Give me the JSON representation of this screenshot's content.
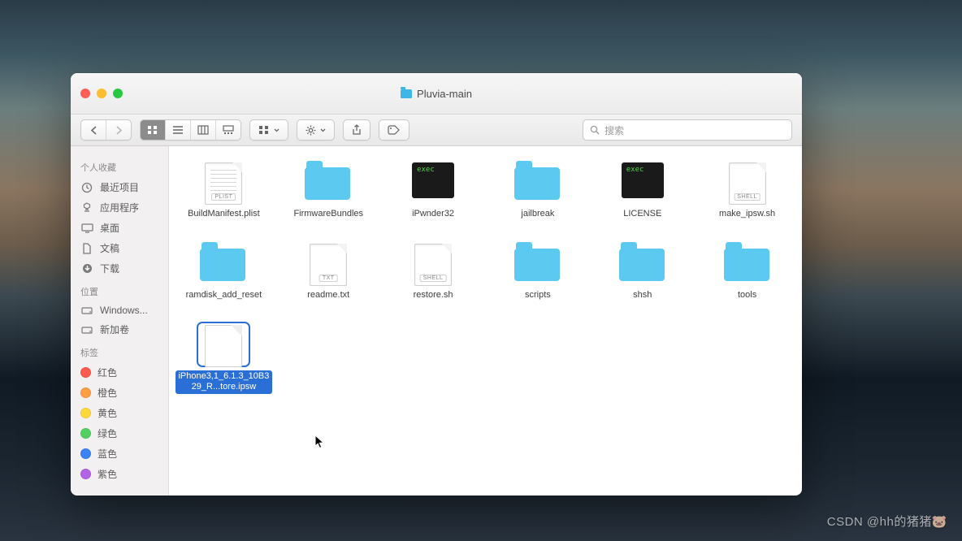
{
  "window": {
    "title": "Pluvia-main"
  },
  "toolbar": {
    "search_placeholder": "搜索"
  },
  "sidebar": {
    "sections": [
      {
        "header": "个人收藏",
        "items": [
          {
            "icon": "clock",
            "label": "最近项目"
          },
          {
            "icon": "app",
            "label": "应用程序"
          },
          {
            "icon": "desk",
            "label": "桌面"
          },
          {
            "icon": "doc",
            "label": "文稿"
          },
          {
            "icon": "down",
            "label": "下载"
          }
        ]
      },
      {
        "header": "位置",
        "items": [
          {
            "icon": "disk",
            "label": "Windows..."
          },
          {
            "icon": "disk",
            "label": "新加卷"
          }
        ]
      },
      {
        "header": "标签",
        "items": [
          {
            "icon": "tag",
            "color": "#ff5a4d",
            "label": "红色"
          },
          {
            "icon": "tag",
            "color": "#ff9f43",
            "label": "橙色"
          },
          {
            "icon": "tag",
            "color": "#ffd93b",
            "label": "黄色"
          },
          {
            "icon": "tag",
            "color": "#54d062",
            "label": "绿色"
          },
          {
            "icon": "tag",
            "color": "#3b82f6",
            "label": "蓝色"
          },
          {
            "icon": "tag",
            "color": "#b462e6",
            "label": "紫色"
          }
        ]
      }
    ]
  },
  "files": [
    {
      "type": "plist",
      "name": "BuildManifest.plist",
      "badge": "PLIST"
    },
    {
      "type": "folder",
      "name": "FirmwareBundles"
    },
    {
      "type": "exec",
      "name": "iPwnder32"
    },
    {
      "type": "folder",
      "name": "jailbreak"
    },
    {
      "type": "exec",
      "name": "LICENSE"
    },
    {
      "type": "shell",
      "name": "make_ipsw.sh",
      "badge": "SHELL"
    },
    {
      "type": "folder",
      "name": "ramdisk_add_reset"
    },
    {
      "type": "txt",
      "name": "readme.txt",
      "badge": "TXT"
    },
    {
      "type": "shell",
      "name": "restore.sh",
      "badge": "SHELL"
    },
    {
      "type": "folder",
      "name": "scripts"
    },
    {
      "type": "folder",
      "name": "shsh"
    },
    {
      "type": "folder",
      "name": "tools"
    },
    {
      "type": "blank",
      "name": "iPhone3,1_6.1.3_10B329_R...tore.ipsw",
      "selected": true
    }
  ],
  "watermark": "CSDN @hh的猪猪🐷"
}
